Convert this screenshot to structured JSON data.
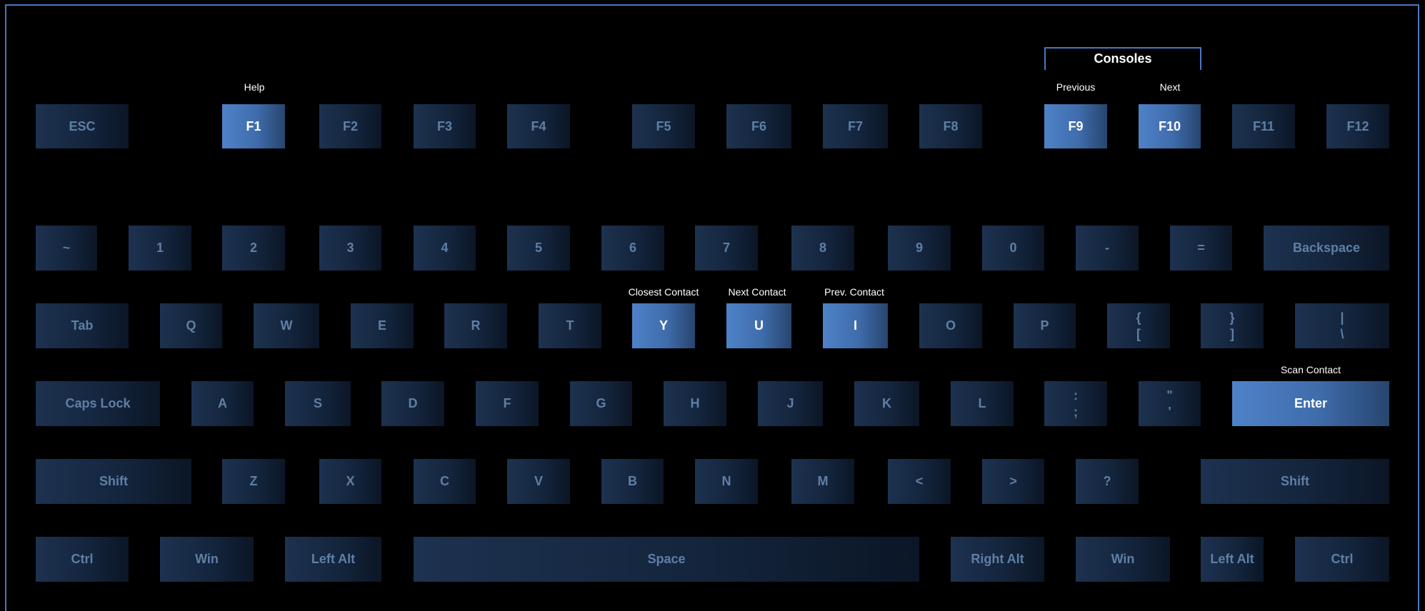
{
  "labels": {
    "help": "Help",
    "consoles": "Consoles",
    "previous": "Previous",
    "next": "Next",
    "closest_contact": "Closest Contact",
    "next_contact": "Next Contact",
    "prev_contact": "Prev. Contact",
    "scan_contact": "Scan Contact"
  },
  "keys": {
    "esc": "ESC",
    "f1": "F1",
    "f2": "F2",
    "f3": "F3",
    "f4": "F4",
    "f5": "F5",
    "f6": "F6",
    "f7": "F7",
    "f8": "F8",
    "f9": "F9",
    "f10": "F10",
    "f11": "F11",
    "f12": "F12",
    "tilde": "~",
    "n1": "1",
    "n2": "2",
    "n3": "3",
    "n4": "4",
    "n5": "5",
    "n6": "6",
    "n7": "7",
    "n8": "8",
    "n9": "9",
    "n0": "0",
    "minus": "-",
    "equals": "=",
    "backspace": "Backspace",
    "tab": "Tab",
    "q": "Q",
    "w": "W",
    "e": "E",
    "r": "R",
    "t": "T",
    "y": "Y",
    "u": "U",
    "i": "I",
    "o": "O",
    "p": "P",
    "lbrace_top": "{",
    "lbrace_bottom": "[",
    "rbrace_top": "}",
    "rbrace_bottom": "]",
    "pipe_top": "|",
    "pipe_bottom": "\\",
    "capslock": "Caps Lock",
    "a": "A",
    "s": "S",
    "d": "D",
    "f": "F",
    "g": "G",
    "h": "H",
    "j": "J",
    "k": "K",
    "l": "L",
    "colon_top": ":",
    "colon_bottom": ";",
    "quote_top": "\"",
    "quote_bottom": "'",
    "enter": "Enter",
    "lshift": "Shift",
    "z": "Z",
    "x": "X",
    "c": "C",
    "v": "V",
    "b": "B",
    "n": "N",
    "m": "M",
    "lt": "<",
    "gt": ">",
    "question": "?",
    "rshift": "Shift",
    "lctrl": "Ctrl",
    "lwin": "Win",
    "lalt": "Left Alt",
    "space": "Space",
    "ralt": "Right Alt",
    "rwin": "Win",
    "ralt2": "Left Alt",
    "rctrl": "Ctrl"
  },
  "colors": {
    "key_base": "#14253d",
    "key_text": "#5f7fa5",
    "key_highlight": "#4e82c8",
    "frame_border": "#4a78c0"
  }
}
